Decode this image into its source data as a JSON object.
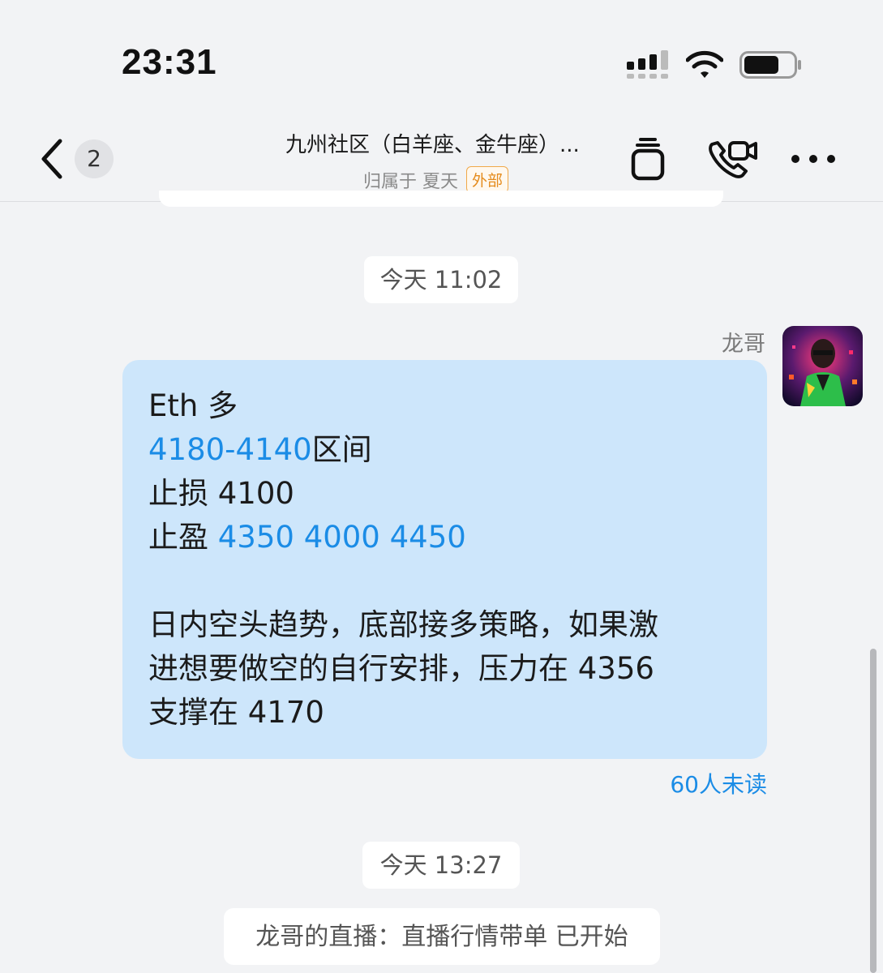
{
  "status_bar": {
    "time": "23:31"
  },
  "header": {
    "unread_count": "2",
    "title": "九州社区（白羊座、金牛座）...",
    "subtitle": "归属于 夏天",
    "external_tag": "外部"
  },
  "messages": {
    "timestamp_1": "今天 11:02",
    "sender_name": "龙哥",
    "line_1": "Eth 多",
    "line_2_range": "4180-4140",
    "line_2_rest": "区间",
    "line_3": "止损 4100",
    "line_4_label": "止盈 ",
    "line_4_numbers": "4350 4000 4450",
    "line_5": "日内空头趋势，底部接多策略，如果激",
    "line_6": "进想要做空的自行安排，压力在 4356",
    "line_7": "支撑在 4170",
    "read_status": "60人未读",
    "timestamp_2": "今天 13:27",
    "live_notice": "龙哥的直播：直播行情带单 已开始"
  },
  "colors": {
    "bubble": "#cde6fb",
    "link": "#1b8ce6",
    "background": "#f2f3f5",
    "tag": "#e58b1c"
  },
  "icons": [
    "signal-icon",
    "wifi-icon",
    "battery-icon",
    "back-chevron-icon",
    "copy-icon",
    "call-video-icon",
    "more-icon"
  ]
}
